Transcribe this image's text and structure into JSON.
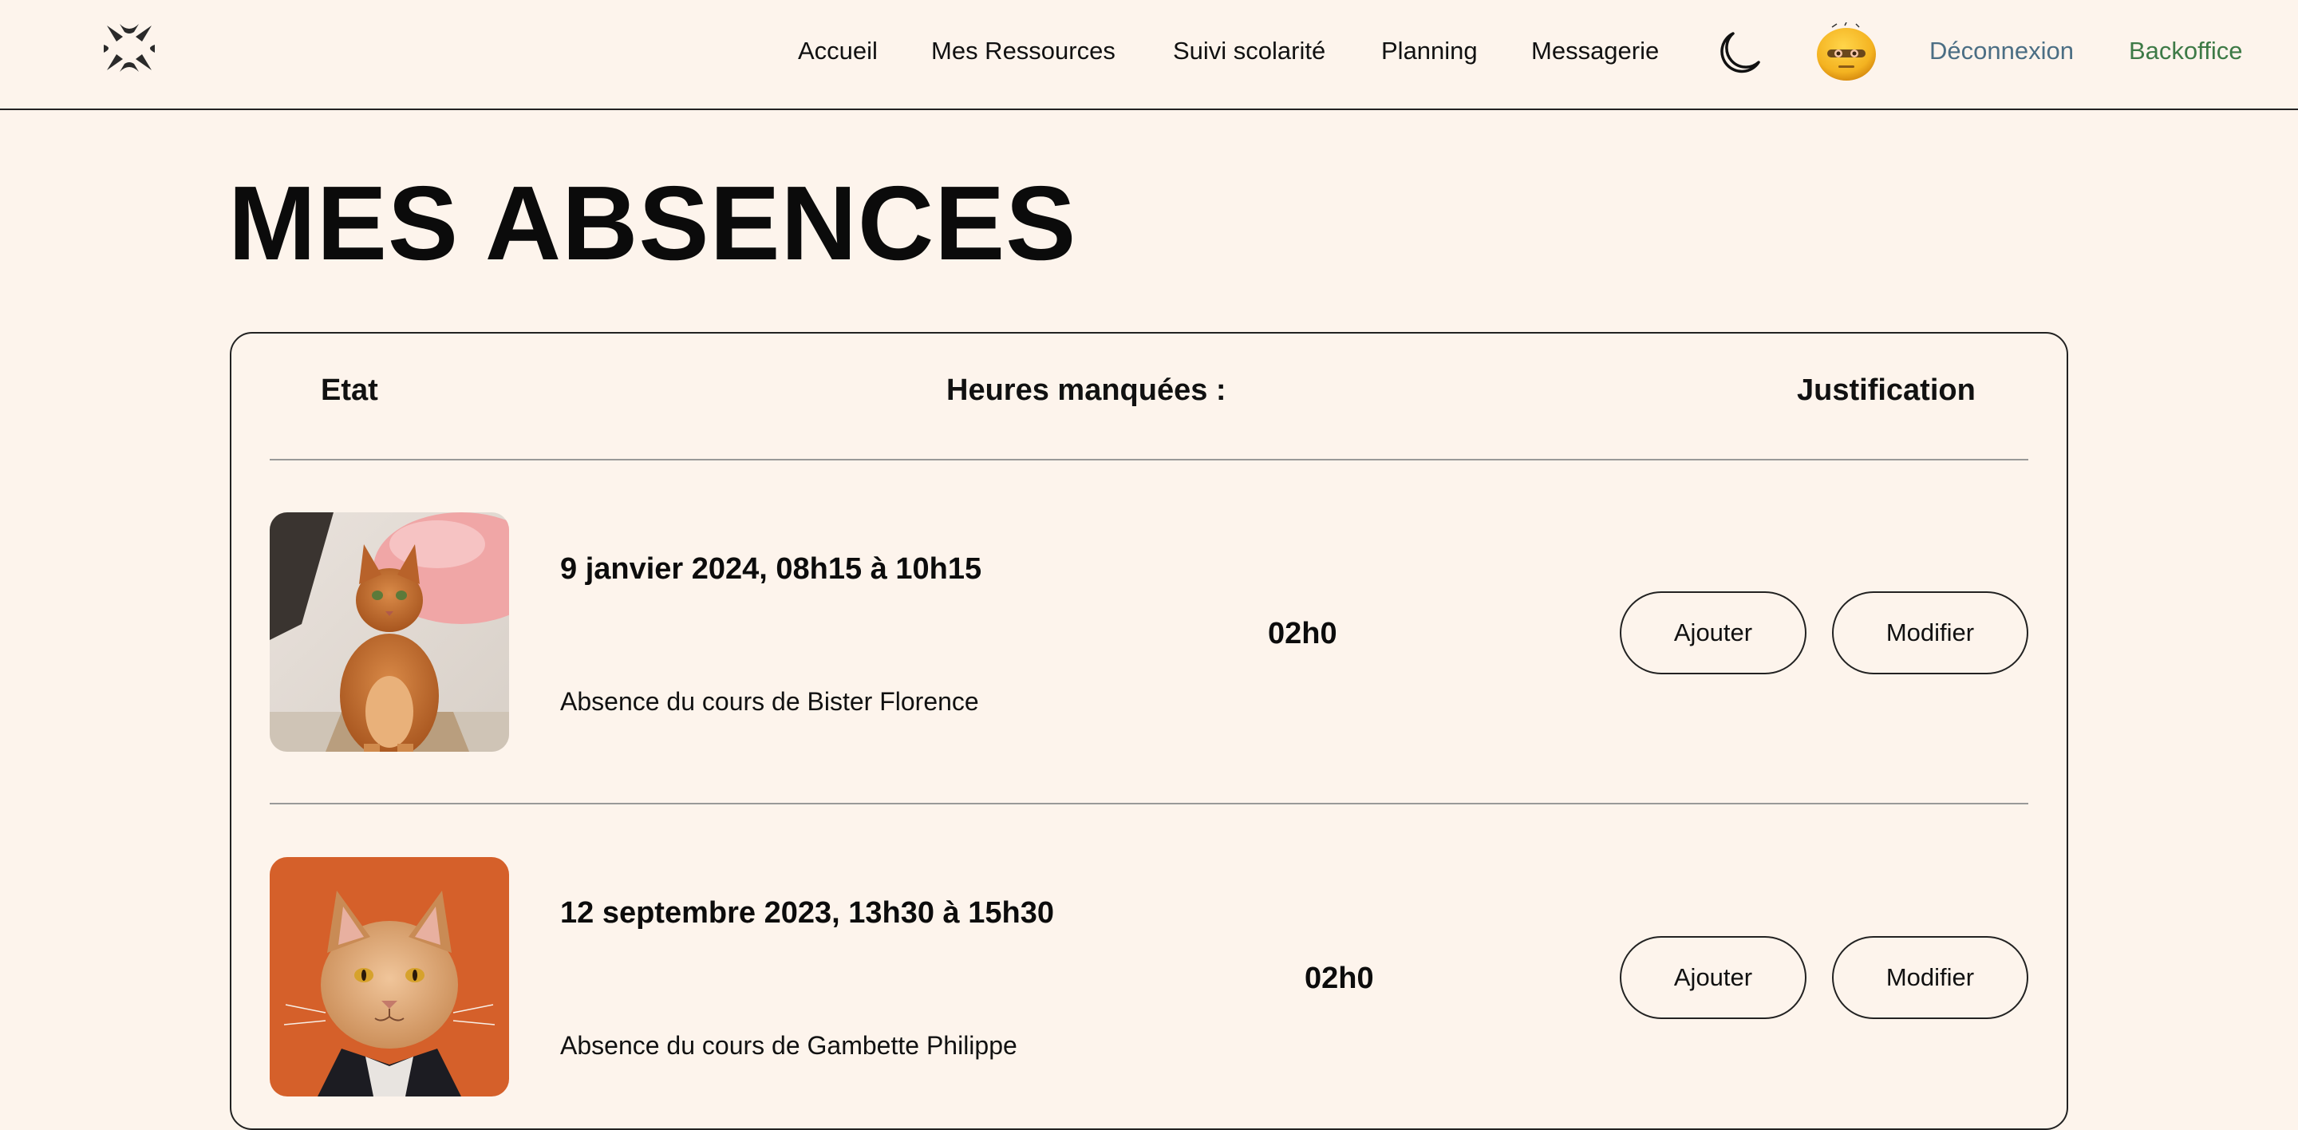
{
  "nav": {
    "items": [
      "Accueil",
      "Mes Ressources",
      "Suivi scolarité",
      "Planning",
      "Messagerie"
    ],
    "logout": "Déconnexion",
    "backoffice": "Backoffice",
    "theme_icon": "moon-icon",
    "logo_icon": "stress-mark-icon"
  },
  "page": {
    "title": "MES ABSENCES"
  },
  "table": {
    "headers": {
      "state": "Etat",
      "hours": "Heures manquées :",
      "justification": "Justification"
    },
    "rows": [
      {
        "date": "9 janvier 2024, 08h15 à 10h15",
        "description": "Absence du cours de Bister Florence",
        "hours": "02h0",
        "add_label": "Ajouter",
        "edit_label": "Modifier",
        "photo": "ginger-cat-photo"
      },
      {
        "date": "12 septembre 2023, 13h30 à 15h30",
        "description": "Absence du cours de Gambette Philippe",
        "hours": "02h0",
        "add_label": "Ajouter",
        "edit_label": "Modifier",
        "photo": "cat-orange-background-photo"
      }
    ]
  },
  "colors": {
    "background": "#fdf4ec",
    "logout_link": "#4b6e84",
    "backoffice_link": "#3d7a46"
  }
}
